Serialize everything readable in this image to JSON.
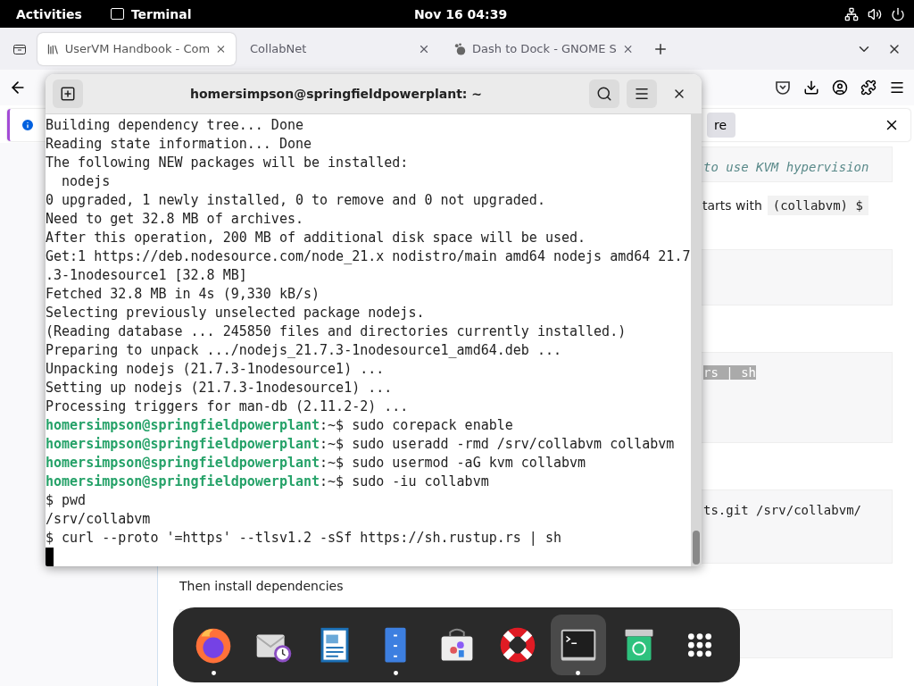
{
  "top_bar": {
    "activities": "Activities",
    "app": "Terminal",
    "clock": "Nov 16  04:39"
  },
  "browser": {
    "tabs": [
      {
        "title": "UserVM Handbook - Com",
        "selected": true
      },
      {
        "title": "CollabNet",
        "selected": false
      },
      {
        "title": "Dash to Dock - GNOME S",
        "selected": false
      }
    ],
    "notification": {
      "button": "re"
    },
    "content": [
      {
        "kind": "comment-block",
        "text": "to use KVM hypervision"
      },
      {
        "kind": "code-paragraph",
        "text": "tarts with",
        "code": "(collabvm) $"
      },
      {
        "kind": "empty-block"
      },
      {
        "kind": "selection-block",
        "text": "rs | sh"
      },
      {
        "kind": "code-block",
        "text": "ts.git /srv/collabvm/"
      },
      {
        "kind": "paragraph",
        "text": "Then install dependencies"
      },
      {
        "kind": "empty-block"
      }
    ]
  },
  "terminal": {
    "title": "homersimpson@springfieldpowerplant: ~",
    "lines": [
      {
        "kind": "output",
        "text": "Building dependency tree... Done"
      },
      {
        "kind": "output",
        "text": "Reading state information... Done"
      },
      {
        "kind": "output",
        "text": "The following NEW packages will be installed:"
      },
      {
        "kind": "output",
        "text": "  nodejs"
      },
      {
        "kind": "output",
        "text": "0 upgraded, 1 newly installed, 0 to remove and 0 not upgraded."
      },
      {
        "kind": "output",
        "text": "Need to get 32.8 MB of archives."
      },
      {
        "kind": "output",
        "text": "After this operation, 200 MB of additional disk space will be used."
      },
      {
        "kind": "output",
        "text": "Get:1 https://deb.nodesource.com/node_21.x nodistro/main amd64 nodejs amd64 21.7"
      },
      {
        "kind": "output",
        "text": ".3-1nodesource1 [32.8 MB]"
      },
      {
        "kind": "output",
        "text": "Fetched 32.8 MB in 4s (9,330 kB/s)"
      },
      {
        "kind": "output",
        "text": "Selecting previously unselected package nodejs."
      },
      {
        "kind": "output",
        "text": "(Reading database ... 245850 files and directories currently installed.)"
      },
      {
        "kind": "output",
        "text": "Preparing to unpack .../nodejs_21.7.3-1nodesource1_amd64.deb ..."
      },
      {
        "kind": "output",
        "text": "Unpacking nodejs (21.7.3-1nodesource1) ..."
      },
      {
        "kind": "output",
        "text": "Setting up nodejs (21.7.3-1nodesource1) ..."
      },
      {
        "kind": "output",
        "text": "Processing triggers for man-db (2.11.2-2) ..."
      },
      {
        "kind": "prompt",
        "user": "homersimpson@springfieldpowerplant",
        "text": ":~$ sudo corepack enable"
      },
      {
        "kind": "prompt",
        "user": "homersimpson@springfieldpowerplant",
        "text": ":~$ sudo useradd -rmd /srv/collabvm collabvm"
      },
      {
        "kind": "prompt",
        "user": "homersimpson@springfieldpowerplant",
        "text": ":~$ sudo usermod -aG kvm collabvm"
      },
      {
        "kind": "prompt",
        "user": "homersimpson@springfieldpowerplant",
        "text": ":~$ sudo -iu collabvm"
      },
      {
        "kind": "output",
        "text": "$ pwd"
      },
      {
        "kind": "output",
        "text": "/srv/collabvm"
      },
      {
        "kind": "output",
        "text": "$ curl --proto '=https' --tlsv1.2 -sSf https://sh.rustup.rs | sh"
      },
      {
        "kind": "cursor"
      }
    ]
  },
  "dock": {
    "apps": [
      {
        "running": true,
        "selected": false
      },
      {
        "running": false,
        "selected": false
      },
      {
        "running": false,
        "selected": false
      },
      {
        "running": true,
        "selected": false
      },
      {
        "running": false,
        "selected": false
      },
      {
        "running": false,
        "selected": false
      },
      {
        "running": true,
        "selected": true
      },
      {
        "running": false,
        "selected": false
      },
      {
        "running": false,
        "selected": false
      }
    ]
  }
}
